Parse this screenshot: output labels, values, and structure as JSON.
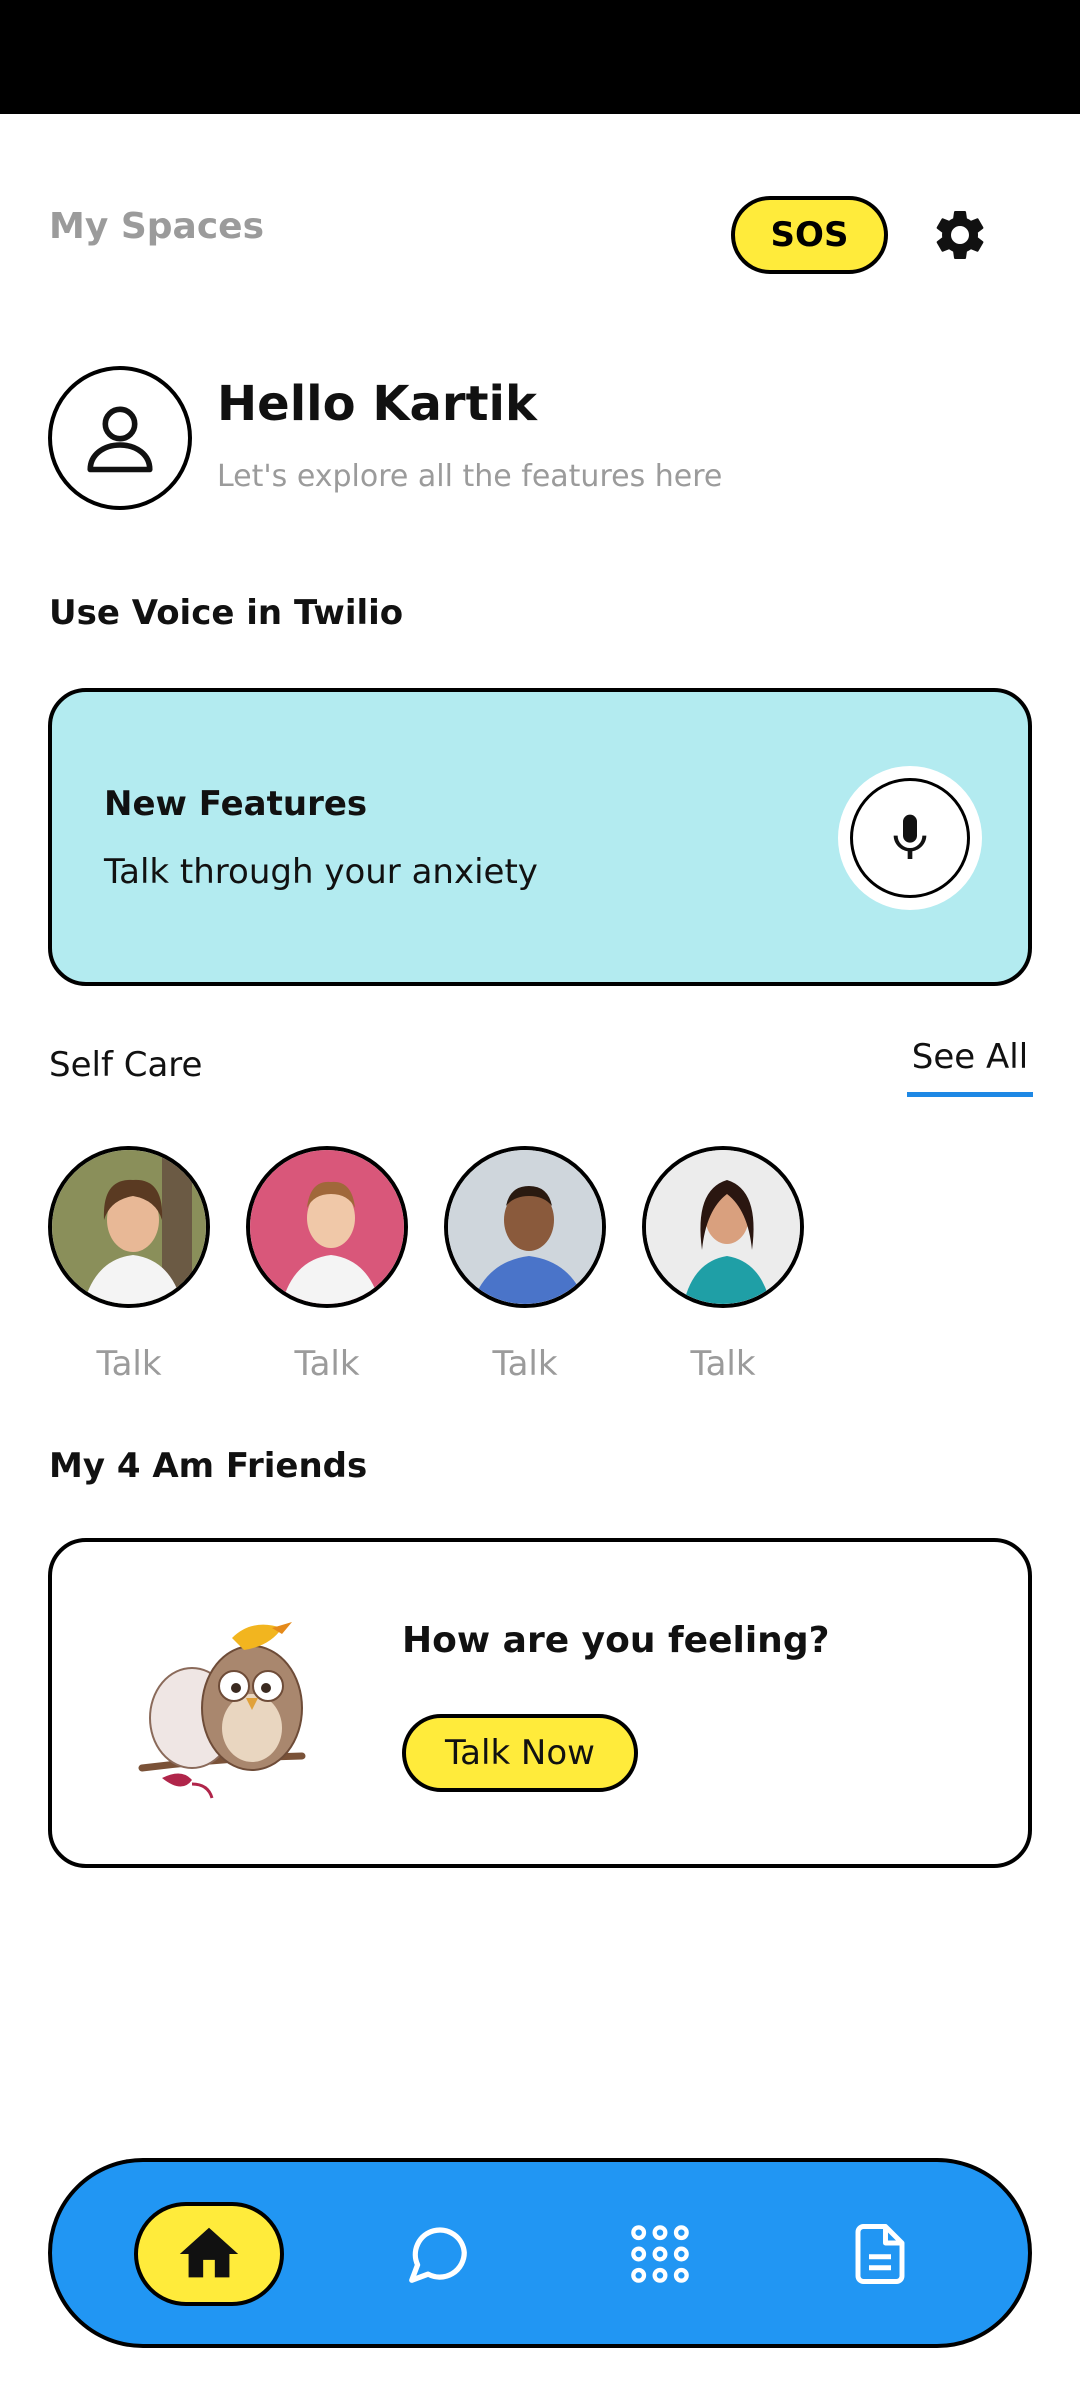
{
  "header": {
    "title": "My Spaces",
    "sos_label": "SOS",
    "settings_icon": "gear-icon"
  },
  "profile": {
    "greeting": "Hello Kartik",
    "subtitle": "Let's explore all the features here",
    "avatar_icon": "user-icon"
  },
  "voice": {
    "section_title": "Use Voice in Twilio",
    "card_title": "New Features",
    "card_subtitle": "Talk through your anxiety",
    "mic_icon": "microphone-icon"
  },
  "self_care": {
    "title": "Self Care",
    "see_all": "See All",
    "people": [
      {
        "label": "Talk",
        "bg": "#8a8f5a",
        "coat": "#f4f4f4"
      },
      {
        "label": "Talk",
        "bg": "#d9577a",
        "coat": "#f4f4f4"
      },
      {
        "label": "Talk",
        "bg": "#cfd6dc",
        "coat": "#4a74c9"
      },
      {
        "label": "Talk",
        "bg": "#ececec",
        "coat": "#1f9fa6"
      }
    ]
  },
  "friends": {
    "section_title": "My 4 Am Friends",
    "question": "How are you feeling?",
    "button_label": "Talk Now"
  },
  "nav": {
    "items": [
      "home-icon",
      "chat-icon",
      "apps-grid-icon",
      "document-icon"
    ],
    "active": "home-icon"
  },
  "colors": {
    "accent_yellow": "#FFEB3B",
    "nav_blue": "#2196F3",
    "card_cyan": "#B3EBF0",
    "underline_blue": "#1E88E5"
  }
}
